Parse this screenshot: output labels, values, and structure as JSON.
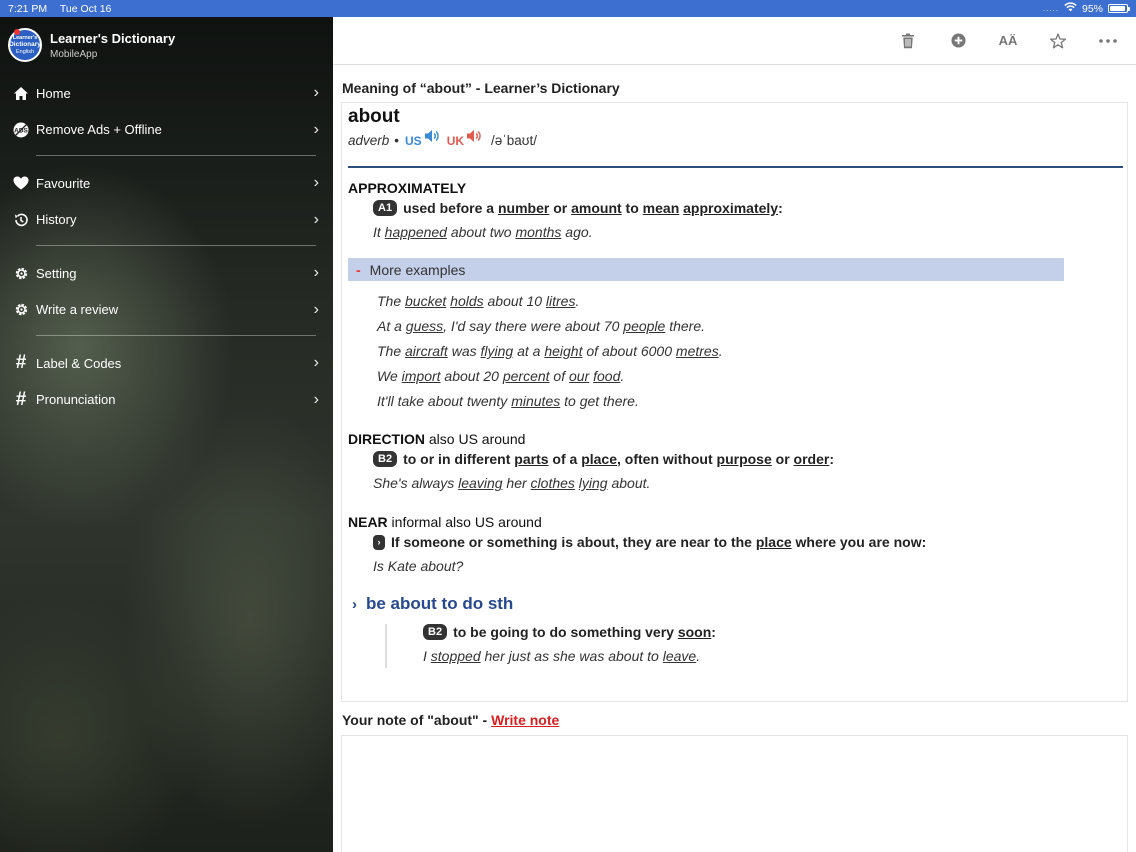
{
  "status": {
    "time": "7:21 PM",
    "date": "Tue Oct 16",
    "battery": "95%",
    "battery_level": 0.95
  },
  "app": {
    "name": "Learner's Dictionary",
    "subtitle": "MobileApp",
    "logo_text": [
      "Learner's",
      "Dictionary",
      "English"
    ]
  },
  "menu": [
    {
      "label": "Home",
      "icon": "home-icon"
    },
    {
      "label": "Remove Ads + Offline",
      "icon": "no-ads-icon"
    },
    {
      "label": "Favourite",
      "icon": "heart-icon"
    },
    {
      "label": "History",
      "icon": "history-icon"
    },
    {
      "label": "Setting",
      "icon": "gear-icon"
    },
    {
      "label": "Write a review",
      "icon": "gear-icon"
    },
    {
      "label": "Label & Codes",
      "icon": "hash-icon"
    },
    {
      "label": "Pronunciation",
      "icon": "hash-icon"
    }
  ],
  "toolbar": {
    "font_label": "AÄ"
  },
  "page_heading": "Meaning of “about” - Learner’s Dictionary",
  "entry": {
    "headword": "about",
    "pos": "adverb",
    "bullet": "•",
    "us": "US",
    "uk": "UK",
    "ipa": "/əˈbaʊt/",
    "s1": {
      "head": "APPROXIMATELY",
      "level": "A1",
      "def_parts": [
        "used before a ",
        "number",
        " or ",
        "amount",
        " to ",
        "mean",
        " ",
        "approximately",
        ":"
      ],
      "ex_parts": [
        "It ",
        "happened",
        " about two ",
        "months",
        " ago."
      ]
    },
    "more_label": "More examples",
    "more_minus": "-",
    "more": [
      [
        "The ",
        "bucket",
        " ",
        "holds",
        " about 10 ",
        "litres",
        "."
      ],
      [
        "At a ",
        "guess",
        ", I'd say there were about 70 ",
        "people",
        " there."
      ],
      [
        "The ",
        "aircraft",
        " was ",
        "flying",
        " at a ",
        "height",
        " of about 6000 ",
        "metres",
        "."
      ],
      [
        "We ",
        "import",
        " about 20 ",
        "percent",
        " of ",
        "our",
        " ",
        "food",
        "."
      ],
      [
        "It'll take about twenty ",
        "minutes",
        " to get there."
      ]
    ],
    "s2": {
      "head": "DIRECTION",
      "head_rest": " also US around",
      "level": "B2",
      "def_parts": [
        "to or in different ",
        "parts",
        " of a ",
        "place",
        ", often without ",
        "purpose",
        " or ",
        "order",
        ":"
      ],
      "ex_parts": [
        "She's always ",
        "leaving",
        " her ",
        "clothes",
        " ",
        "lying",
        " about."
      ]
    },
    "s3": {
      "head": "NEAR",
      "head_rest": " informal also US around",
      "level": "›",
      "def_parts": [
        "If someone or something is about, they are near to the ",
        "place",
        " where you are now:"
      ],
      "ex_parts": [
        "Is Kate about?"
      ]
    },
    "idiom": {
      "chevron": "›",
      "title": "be about to do sth",
      "level": "B2",
      "def_parts": [
        "to be going to do something very ",
        "soon",
        ":"
      ],
      "ex_parts": [
        "I ",
        "stopped",
        " her just as she was about to ",
        "leave",
        "."
      ]
    }
  },
  "note": {
    "prefix": "Your note of \"about\" - ",
    "link": "Write note"
  }
}
